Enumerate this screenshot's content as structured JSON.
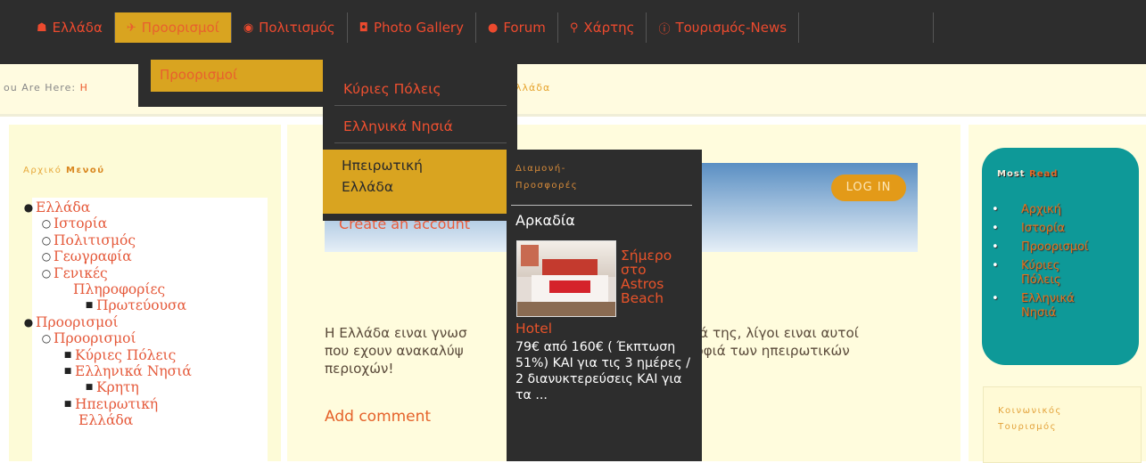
{
  "nav": {
    "items": [
      {
        "icon": "home-icon",
        "glyph": "☗",
        "label": "Ελλάδα"
      },
      {
        "icon": "plane-icon",
        "glyph": "✈",
        "label": "Προορισμοί"
      },
      {
        "icon": "eye-icon",
        "glyph": "◉",
        "label": "Πολιτισμός"
      },
      {
        "icon": "camera-icon",
        "glyph": "◘",
        "label": "Photo Gallery"
      },
      {
        "icon": "comment-icon",
        "glyph": "●",
        "label": "Forum"
      },
      {
        "icon": "map-marker-icon",
        "glyph": "⚲",
        "label": "Χάρτης"
      },
      {
        "icon": "info-icon",
        "glyph": "ⓘ",
        "label": "Τουρισμός-News"
      }
    ],
    "active": "Προορισμοί"
  },
  "breadcrumb": {
    "label": "ou Are Here:",
    "first": "H",
    "last": "λλάδα"
  },
  "left_menu": {
    "title_a": "Αρχικό ",
    "title_b": "Μενού",
    "items": [
      "Ελλάδα",
      "Ιστορία",
      "Πολιτισμός",
      "Γεωγραφία",
      "Γενικές",
      "Πληροφορίες",
      "Πρωτεύουσα",
      "Προορισμοί",
      "Προορισμοί",
      "Κύριες Πόλεις",
      "Ελληνικά Νησιά",
      "Κρητη",
      "Ηπειρωτική",
      "Ελλάδα"
    ]
  },
  "login": {
    "button": "LOG IN",
    "create_account": "Create an account"
  },
  "article": {
    "line1a": "Η Ελλάδα ειναι γνωσ",
    "line1b": "ιά της, λίγοι ειναι αυτοί",
    "line2a": "που εχουν ανακαλύψ",
    "line2b": "ρφιά των ηπειρωτικών",
    "line3": "περιοχών!",
    "add_comment": "Add comment"
  },
  "most_read": {
    "title_a": "Most ",
    "title_b": "Read",
    "items": [
      "Αρχική",
      "Ιστορία",
      "Προορισμοί",
      "Κύριες Πόλεις",
      "Ελληνικά Νησιά"
    ]
  },
  "social": {
    "line1": "Κοινωνικός",
    "line2": "Τουρισμός"
  },
  "dropdown1": {
    "item": "Προορισμοί"
  },
  "dropdown2": {
    "items": [
      "Κύριες Πόλεις",
      "Ελληνικά Νησιά"
    ],
    "highlight_a": "Ηπειρωτική",
    "highlight_b": "Ελλάδα"
  },
  "dropdown3": {
    "title_a": "Διαμονή-",
    "title_b": "Προσφορές",
    "region": "Αρκαδία",
    "headline": "Σήμερο στο Astros Beach",
    "headline_end": "Hotel",
    "offer": "79€ από 160€ ( Έκπτωση 51%) ΚΑΙ για τις 3 ημέρες / 2 διανυκτερεύσεις ΚΑΙ για τα ..."
  },
  "colors": {
    "accent": "#d9a420",
    "link": "#ec4a2e",
    "nav_bg": "#2d2d2d",
    "teal": "#0e9998"
  }
}
